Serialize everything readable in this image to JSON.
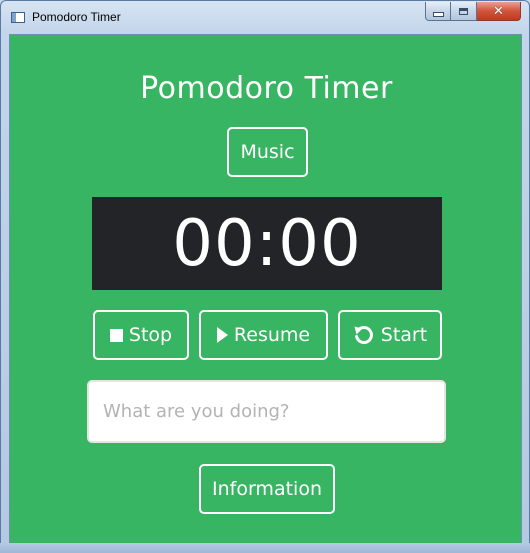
{
  "window": {
    "title": "Pomodoro Timer",
    "caption": {
      "minimize_icon": "minimize-icon",
      "maximize_icon": "maximize-icon",
      "close_icon": "close-icon",
      "close_glyph": "✕"
    }
  },
  "app": {
    "title": "Pomodoro Timer",
    "music_label": "Music",
    "timer": "00:00",
    "controls": {
      "stop_label": "Stop",
      "stop_icon": "stop-icon",
      "resume_label": "Resume",
      "resume_icon": "play-icon",
      "start_label": "Start",
      "start_icon": "restart-icon"
    },
    "task": {
      "value": "",
      "placeholder": "What are you doing?"
    },
    "information_label": "Information"
  },
  "colors": {
    "background": "#38b562",
    "timer_panel": "#232428",
    "text": "#ffffff",
    "input_border": "#e5e5e5",
    "placeholder": "#b3b3b3"
  }
}
